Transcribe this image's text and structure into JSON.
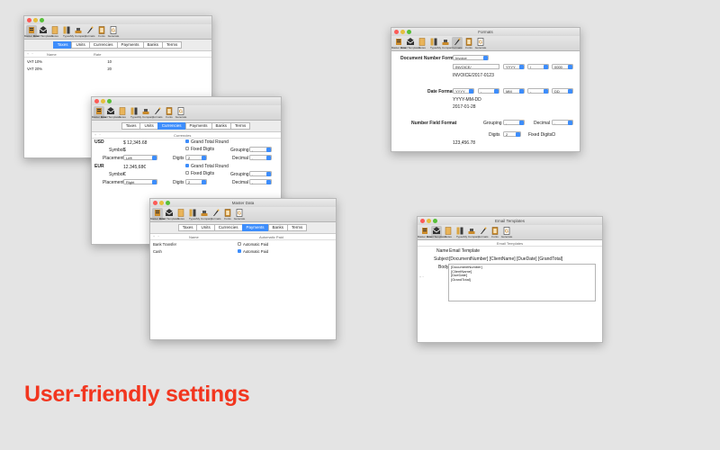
{
  "toolbar_items": [
    "Master Data",
    "Email Templates",
    "Notes",
    "Types",
    "My Company",
    "Formats",
    "Fonts",
    "Generate"
  ],
  "tabs": [
    "Taxes",
    "Units",
    "Currencies",
    "Payments",
    "Banks",
    "Terms"
  ],
  "taxes_window": {
    "columns": [
      "Name",
      "Rate"
    ],
    "rows": [
      {
        "name": "VAT 10%",
        "rate": "10"
      },
      {
        "name": "VAT 20%",
        "rate": "20"
      }
    ]
  },
  "currencies_window": {
    "column_header": "Currencies",
    "currencies": [
      {
        "code": "USD",
        "sample": "$ 12,345.68",
        "symbol_label": "Symbol",
        "symbol": "$",
        "placement_label": "Placement",
        "placement": "Left",
        "grand_total": "Grand Total Round",
        "fixed_digits": "Fixed Digits",
        "grouping_label": "Grouping",
        "grouping": ",",
        "digits_label": "Digits",
        "digits": "2",
        "decimal_label": "Decimal",
        "decimal": "."
      },
      {
        "code": "EUR",
        "sample": "12.345,68€",
        "symbol_label": "Symbol",
        "symbol": "€",
        "placement_label": "Placement",
        "placement": "Right",
        "grand_total": "Grand Total Round",
        "fixed_digits": "Fixed Digits",
        "grouping_label": "Grouping",
        "grouping": ".",
        "digits_label": "Digits",
        "digits": "2",
        "decimal_label": "Decimal",
        "decimal": ","
      }
    ]
  },
  "payments_window": {
    "title": "Master Data",
    "columns": [
      "Name",
      "Automatic Paid"
    ],
    "rows": [
      {
        "name": "Bank Transfer",
        "auto": "Automatic Paid",
        "checked": false
      },
      {
        "name": "Cash",
        "auto": "Automatic Paid",
        "checked": true
      }
    ]
  },
  "formats_window": {
    "title": "Formats",
    "doc_number_label": "Document Number Format",
    "doc_type": "Invoice",
    "doc_prefix": "INVOICE/",
    "doc_year": "YYYY",
    "doc_sep": "/",
    "doc_counter": "0000",
    "doc_preview": "INVOICE/2017-0123",
    "date_label": "Date Format",
    "date_year": "YYYY",
    "date_sep1": "-",
    "date_month": "MM",
    "date_sep2": "-",
    "date_day": "DD",
    "date_pattern": "YYYY-MM-DD",
    "date_preview": "2017-01-28",
    "number_label": "Number Field Format",
    "grouping_label": "Grouping",
    "grouping": ",",
    "decimal_label": "Decimal",
    "decimal": ".",
    "digits_label": "Digits",
    "digits": "2",
    "fixed_label": "Fixed Digits",
    "number_preview": "123,456.78"
  },
  "email_window": {
    "title": "Email Templates",
    "header": "Email Templates",
    "name_label": "Name",
    "name_value": "Email Template",
    "subject_label": "Subject",
    "subject_value": "[DocumentNumber] [ClientName] [DueDate] [GrandTotal]",
    "body_label": "Body",
    "body_lines": [
      "[DocumentNumber]",
      "[ClientName]",
      "[DueDate]",
      "[GrandTotal]"
    ]
  },
  "headline": "User-friendly settings",
  "colors": {
    "accent": "#3d8dfb",
    "headline": "#f2361f",
    "background": "#e4e4e4"
  }
}
